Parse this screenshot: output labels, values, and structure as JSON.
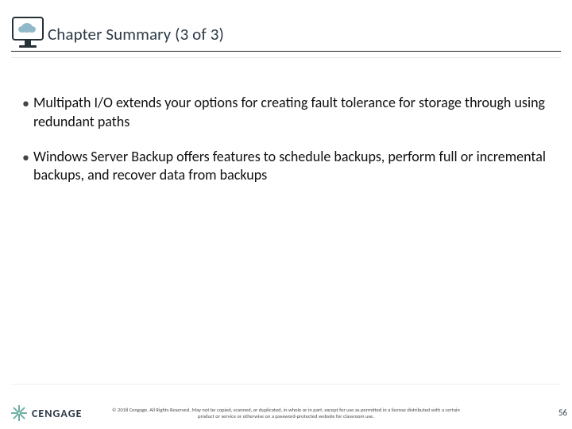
{
  "title": "Chapter Summary (3 of 3)",
  "bullets": [
    "Multipath I/O extends your  options for creating fault tolerance for storage through using redundant paths",
    "Windows Server Backup offers features to schedule backups, perform full or incremental backups, and recover data from backups"
  ],
  "brand": {
    "name": "CENGAGE"
  },
  "copyright": "© 2018 Cengage. All Rights Reserved. May not be copied, scanned, or duplicated, in whole or in part, except for use as permitted in a license distributed with a certain product or service or otherwise on a password-protected website for classroom use.",
  "page_number": "56"
}
